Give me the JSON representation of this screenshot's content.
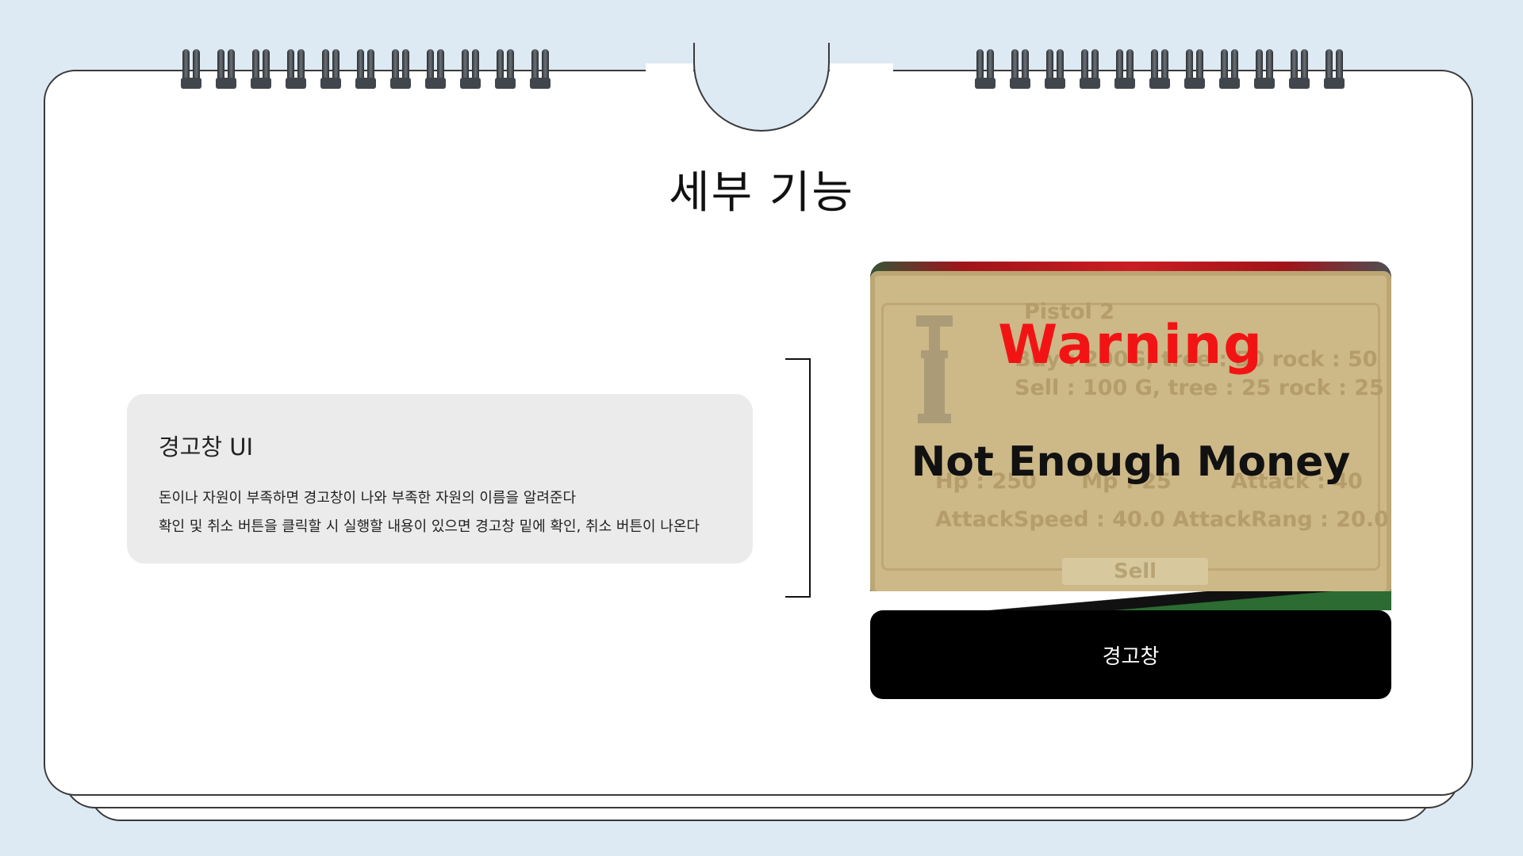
{
  "slide": {
    "title": "세부 기능"
  },
  "description_card": {
    "title": "경고창 UI",
    "lines": [
      "돈이나 자원이 부족하면 경고창이 나와 부족한 자원의 이름을 알려준다",
      "확인 및 취소 버튼을 클릭할 시 실행할 내용이 있으면 경고창 밑에 확인, 취소 버튼이 나온다"
    ]
  },
  "screenshot": {
    "warning_title": "Warning",
    "warning_message": "Not Enough Money",
    "background_lines": {
      "name": "Pistol 2",
      "buy": "Buy : 200G, tree : 50 rock : 50",
      "sell": "Sell : 100 G, tree : 25 rock : 25",
      "stats": "Hp : 250      Mp : 25        Attack : 40",
      "speed": "AttackSpeed : 40.0 AttackRang : 20.0",
      "sell_button": "Sell"
    }
  },
  "caption": {
    "label": "경고창"
  },
  "colors": {
    "background": "#dde9f3",
    "warning_red": "#f21414",
    "card_gray": "#ebebeb",
    "panel_tan": "#cdb887"
  }
}
